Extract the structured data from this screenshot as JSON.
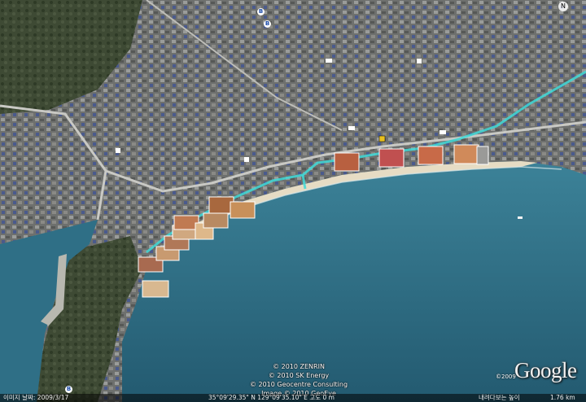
{
  "attribution": {
    "line1": "© 2010 ZENRIN",
    "line2": "© 2010 SK Energy",
    "line3": "© 2010 Geocentre Consulting",
    "line4": "Image © 2010 GeoEye"
  },
  "logo": {
    "text": "Google",
    "year": "©2009"
  },
  "status": {
    "image_date": "이미지 날짜: 2009/3/17",
    "coordinates": "35°09'29.35\" N   129°09'35.10\" E   고도   0 m",
    "stream_status": "내려다보는 높이",
    "eye_alt": "1.76 km"
  },
  "compass": {
    "label": "N"
  },
  "poi": {
    "b1": "B",
    "b2": "B",
    "b3": "B"
  },
  "colors": {
    "sea": "#2e6e86",
    "land": "#6a6c6a",
    "sand": "#e6dcc4",
    "route": "#40d9d8"
  }
}
